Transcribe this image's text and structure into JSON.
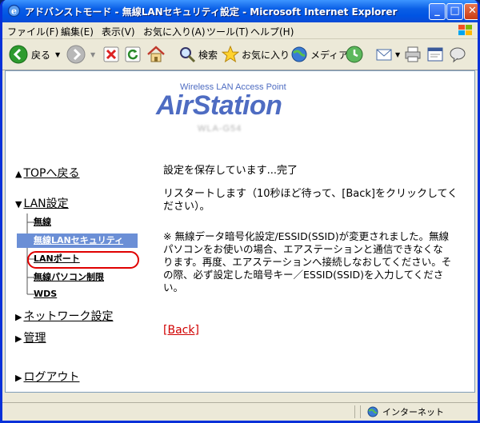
{
  "window": {
    "title": "アドバンストモード - 無線LANセキュリティ設定 - Microsoft Internet Explorer",
    "minimize": "_",
    "maximize": "□",
    "close": "✕"
  },
  "menu": [
    "ファイル(F)",
    "編集(E)",
    "表示(V)",
    "お気に入り(A)",
    "ツール(T)",
    "ヘルプ(H)"
  ],
  "toolbar": {
    "back_label": "戻る",
    "search_label": "検索",
    "favorites_label": "お気に入り",
    "media_label": "メディア"
  },
  "brand": {
    "tagline": "Wireless LAN Access Point",
    "logo": "AirStation",
    "model": "WLA-G54"
  },
  "nav": {
    "top": "TOPへ戻る",
    "lan": "LAN設定",
    "sub": [
      "無線",
      "無線LANセキュリティ",
      "LANポート",
      "無線パソコン制限",
      "WDS"
    ],
    "network": "ネットワーク設定",
    "admin": "管理",
    "logout": "ログアウト"
  },
  "main": {
    "saved": "設定を保存しています...完了",
    "restart": "リスタートします（10秒ほど待って、[Back]をクリックしてください）。",
    "note": "※ 無線データ暗号化設定/ESSID(SSID)が変更されました。無線パソコンをお使いの場合、エアステーションと通信できなくなります。再度、エアステーションへ接続しなおしてください。その際、必ず設定した暗号キー／ESSID(SSID)を入力してください。",
    "back": "[Back]"
  },
  "status": {
    "zone": "インターネット"
  },
  "colors": {
    "highlight": "#6b8fd6",
    "back_link": "#d00000",
    "logo": "#4e6cc2",
    "annotation": "#e00000"
  }
}
